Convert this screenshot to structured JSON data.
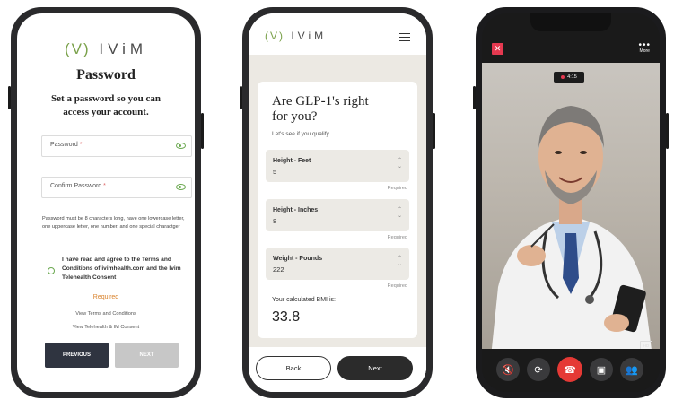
{
  "phone1": {
    "logo_v": "(V)",
    "logo_text": "IViM",
    "title": "Password",
    "subtitle_line1": "Set a password so you can",
    "subtitle_line2": "access your account.",
    "password_label": "Password",
    "confirm_label": "Confirm Password",
    "required_mark": "*",
    "hint": "Password must be 8 characters long, have one lowercase letter, one uppercase letter, one number, and one special charactger",
    "agree_text": "I have read and agree to the Terms and Conditions of ivimhealth.com and the Ivim Telehealth Consent",
    "required_text": "Required",
    "link_terms": "View Terms and Conditions",
    "link_consent": "View Telehealth & IM Consent",
    "btn_previous": "PREVIOUS",
    "btn_next": "NEXT",
    "colors": {
      "accent": "#6aa84f",
      "required": "#d9822b",
      "dark_button": "#2f3440"
    }
  },
  "phone2": {
    "logo_v": "(V)",
    "logo_text": "IViM",
    "title_line1": "Are GLP-1's right",
    "title_line2": "for you?",
    "subtitle": "Let's see if you qualify...",
    "fields": [
      {
        "label": "Height - Feet",
        "value": "5",
        "required": "Required"
      },
      {
        "label": "Height - Inches",
        "value": "8",
        "required": "Required"
      },
      {
        "label": "Weight - Pounds",
        "value": "222",
        "required": "Required"
      }
    ],
    "bmi_label": "Your calculated BMI is:",
    "bmi_value": "33.8",
    "btn_back": "Back",
    "btn_next": "Next",
    "icons": [
      "menu-icon"
    ]
  },
  "phone3": {
    "close": "✕",
    "more_label": "More",
    "timer": "4:15",
    "hd_badge": "HD",
    "controls": [
      "mute-icon",
      "switch-camera-icon",
      "end-call-icon",
      "video-off-icon",
      "participants-icon"
    ],
    "colors": {
      "end_call": "#e53935",
      "close": "#e53950"
    }
  }
}
